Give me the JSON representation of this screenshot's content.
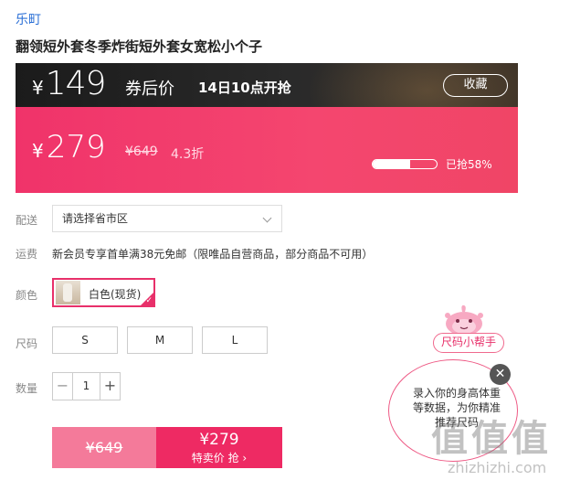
{
  "brand": "乐町",
  "product_title": "翻领短外套冬季炸街短外套女宽松小个子",
  "coupon_bar": {
    "currency": "¥",
    "coupon_price": "149",
    "coupon_label": "券后价",
    "start_time": "14日10点开抢",
    "favorite_label": "收藏"
  },
  "sale_bar": {
    "currency": "¥",
    "sale_price": "279",
    "original_price": "¥649",
    "discount": "4.3折",
    "sold_fraction": 0.58,
    "sold_text": "已抢58%"
  },
  "delivery": {
    "label": "配送",
    "placeholder": "请选择省市区"
  },
  "shipping": {
    "label": "运费",
    "text": "新会员专享首单满38元免邮（限唯品自营商品，部分商品不可用）"
  },
  "color": {
    "label": "颜色",
    "option": "白色(现货)"
  },
  "size": {
    "label": "尺码",
    "options": [
      "S",
      "M",
      "L"
    ]
  },
  "quantity": {
    "label": "数量",
    "minus": "−",
    "value": "1",
    "plus": "+"
  },
  "buy": {
    "original": "¥649",
    "price": "¥279",
    "action": "特卖价 抢 ›"
  },
  "size_helper": {
    "tag": "尺码小帮手",
    "bubble_text": "录入你的身高体重等数据，为你精准推荐尺码",
    "close": "✕"
  },
  "watermark": {
    "big": "值值值",
    "small": "zhizhizhi.com"
  }
}
